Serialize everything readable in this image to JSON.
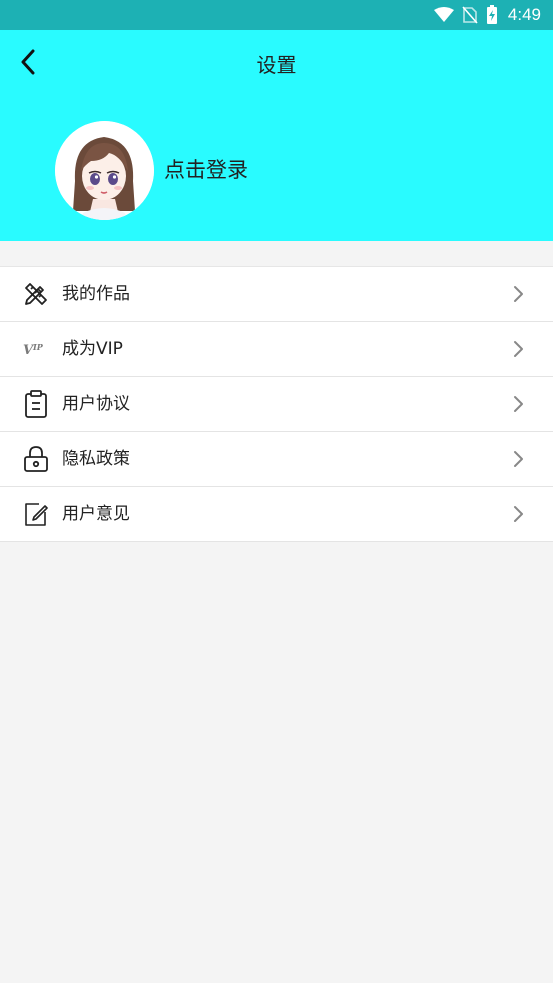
{
  "status_bar": {
    "time": "4:49",
    "icons": [
      "wifi-icon",
      "no-sim-icon",
      "battery-charging-icon"
    ],
    "background": "#1db1b4"
  },
  "header": {
    "title": "设置",
    "background": "#29fbff",
    "back_icon": "chevron-left-icon",
    "login_text": "点击登录"
  },
  "menu": {
    "items": [
      {
        "label": "我的作品",
        "icon": "pencil-ruler-icon"
      },
      {
        "label": "成为VIP",
        "icon": "vip-icon"
      },
      {
        "label": "用户协议",
        "icon": "clipboard-icon"
      },
      {
        "label": "隐私政策",
        "icon": "lock-icon"
      },
      {
        "label": "用户意见",
        "icon": "edit-note-icon"
      }
    ],
    "chevron_icon": "chevron-right-icon"
  }
}
